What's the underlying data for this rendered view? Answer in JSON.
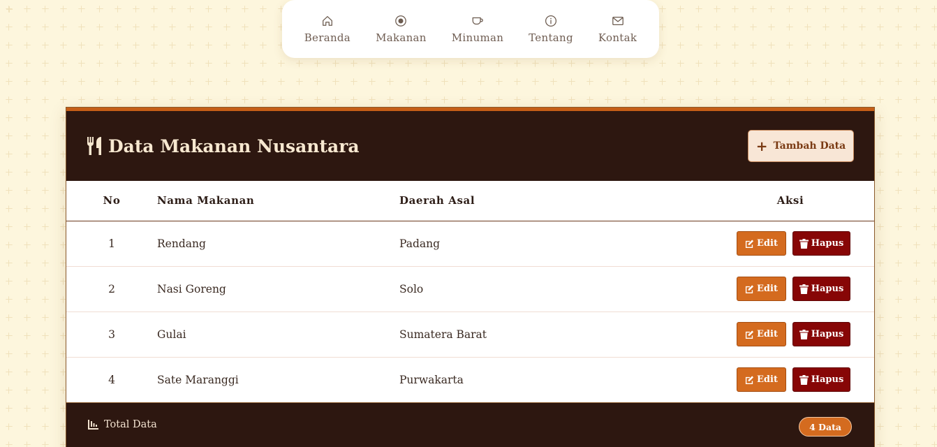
{
  "nav": {
    "items": [
      {
        "label": "Beranda",
        "icon": "home-icon"
      },
      {
        "label": "Makanan",
        "icon": "plate-icon"
      },
      {
        "label": "Minuman",
        "icon": "cup-icon"
      },
      {
        "label": "Tentang",
        "icon": "info-icon"
      },
      {
        "label": "Kontak",
        "icon": "envelope-icon"
      }
    ]
  },
  "card": {
    "title": "Data Makanan Nusantara",
    "title_icon": "utensils-icon",
    "add_button": "Tambah Data"
  },
  "table": {
    "headers": {
      "no": "No",
      "name": "Nama Makanan",
      "region": "Daerah Asal",
      "action": "Aksi"
    },
    "edit_label": "Edit",
    "delete_label": "Hapus",
    "rows": [
      {
        "no": "1",
        "name": "Rendang",
        "region": "Padang"
      },
      {
        "no": "2",
        "name": "Nasi Goreng",
        "region": "Solo"
      },
      {
        "no": "3",
        "name": "Gulai",
        "region": "Sumatera Barat"
      },
      {
        "no": "4",
        "name": "Sate Maranggi",
        "region": "Purwakarta"
      }
    ]
  },
  "footer": {
    "label": "Total Data",
    "label_icon": "chart-icon",
    "badge": "4 Data"
  },
  "colors": {
    "header_bg": "#2d1710",
    "accent": "#c55e17",
    "edit": "#d46b1f",
    "delete": "#870606",
    "page_bg": "#fdf6dd"
  }
}
